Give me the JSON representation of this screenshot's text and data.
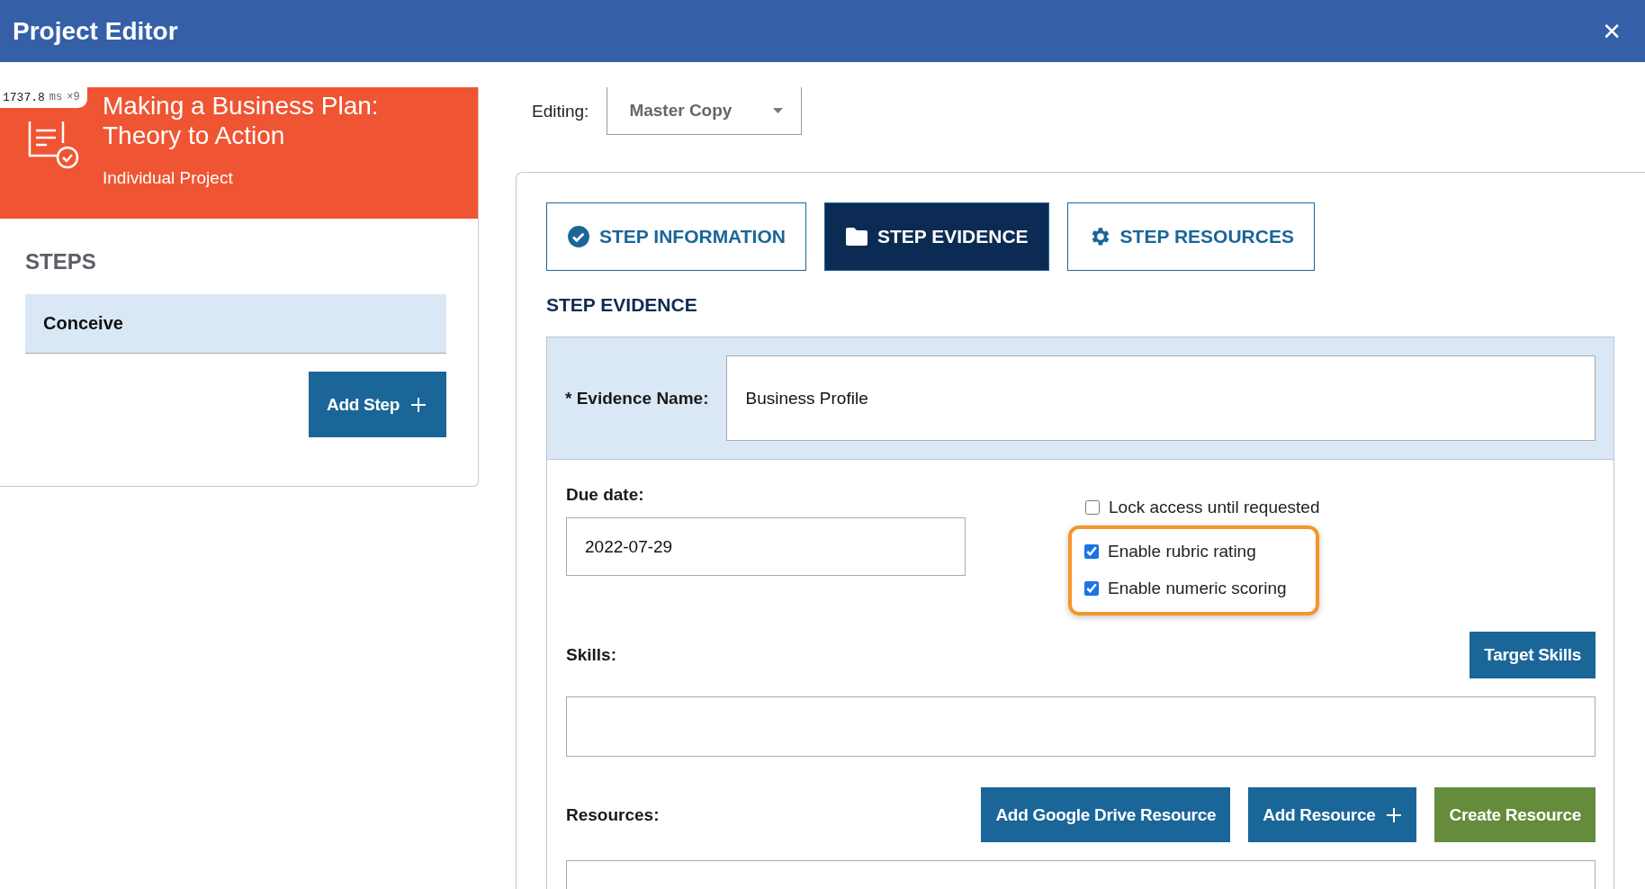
{
  "window": {
    "title": "Project Editor",
    "close": "✕"
  },
  "perf_badge": {
    "value": "1737.8",
    "unit": "ms",
    "count": "×9"
  },
  "project": {
    "title": "Making a Business Plan:\nTheory to Action",
    "type": "Individual Project"
  },
  "steps": {
    "heading": "STEPS",
    "items": [
      {
        "label": "Conceive",
        "selected": true
      }
    ],
    "add_button": "Add Step"
  },
  "editing": {
    "label": "Editing:",
    "value": "Master Copy"
  },
  "tabs": [
    {
      "label": "STEP INFORMATION",
      "selected": false
    },
    {
      "label": "STEP EVIDENCE",
      "selected": true
    },
    {
      "label": "STEP RESOURCES",
      "selected": false
    }
  ],
  "section_title": "STEP EVIDENCE",
  "evidence_name": {
    "label": "* Evidence Name:",
    "value": "Business Profile"
  },
  "due_date": {
    "label": "Due date:",
    "value": "2022-07-29"
  },
  "options": [
    {
      "label": "Lock access until requested",
      "checked": false,
      "highlighted": false
    },
    {
      "label": "Enable rubric rating",
      "checked": true,
      "highlighted": true
    },
    {
      "label": "Enable numeric scoring",
      "checked": true,
      "highlighted": true
    }
  ],
  "skills": {
    "label": "Skills:",
    "button": "Target Skills"
  },
  "resources": {
    "label": "Resources:",
    "buttons": [
      {
        "label": "Add Google Drive Resource",
        "kind": "primary",
        "plus": false
      },
      {
        "label": "Add Resource",
        "kind": "primary",
        "plus": true
      },
      {
        "label": "Create Resource",
        "kind": "create",
        "plus": false
      }
    ]
  }
}
